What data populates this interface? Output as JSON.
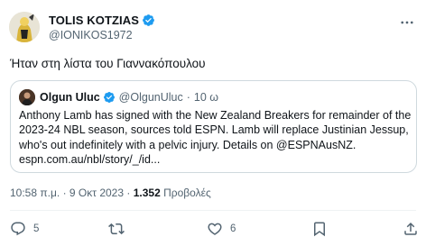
{
  "author": {
    "display_name": "TOLIS KOTZIAS",
    "handle": "@IONIKOS1972",
    "verified": true
  },
  "tweet": {
    "text": "Ήταν στη λίστα του Γιαννακόπουλου"
  },
  "quoted_tweet": {
    "display_name": "Olgun Uluc",
    "handle": "@OlgunUluc",
    "separator": "·",
    "time": "10 ω",
    "verified": true,
    "body_lines": [
      "Anthony Lamb has signed with the New Zealand Breakers for remainder of the",
      "2023-24 NBL season, sources told ESPN. Lamb will replace Justinian Jessup,",
      "who's out indefinitely with a pelvic injury. Details on @ESPNAusNZ.",
      "espn.com.au/nbl/story/_/id..."
    ]
  },
  "meta": {
    "time": "10:58 π.μ.",
    "separator": "·",
    "date": "9 Οκτ 2023",
    "views_count": "1.352",
    "views_label": "Προβολές"
  },
  "actions": {
    "reply_count": "5",
    "retweet_count": "",
    "like_count": "6"
  },
  "colors": {
    "verified_blue": "#1d9bf0",
    "secondary_text": "#536471",
    "border": "#cfd9de"
  }
}
